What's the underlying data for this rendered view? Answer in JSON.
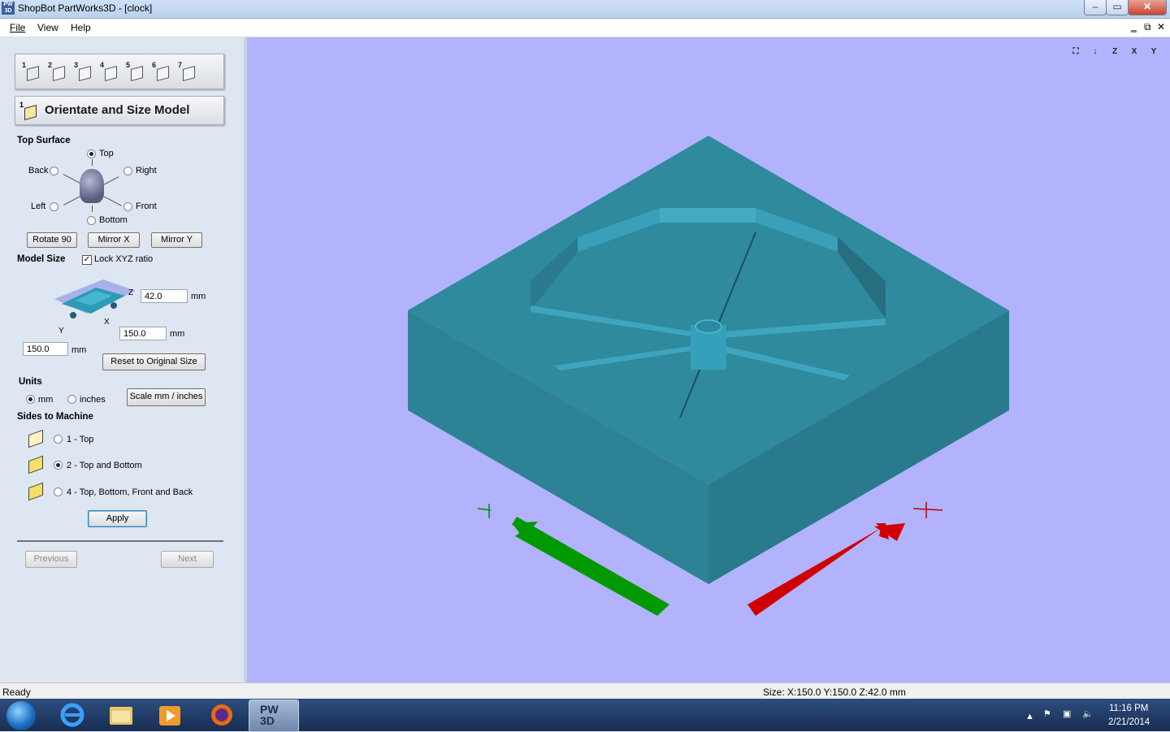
{
  "window": {
    "title": "ShopBot PartWorks3D - [clock]",
    "app_icon_text": "PW\n3D"
  },
  "menu": {
    "items": [
      "File",
      "View",
      "Help"
    ]
  },
  "panel": {
    "steps": [
      "1",
      "2",
      "3",
      "4",
      "5",
      "6",
      "7"
    ],
    "header_title": "Orientate and Size Model",
    "top_surface": {
      "label": "Top Surface",
      "options": {
        "top": "Top",
        "back": "Back",
        "right": "Right",
        "left": "Left",
        "front": "Front",
        "bottom": "Bottom"
      },
      "selected": "Top"
    },
    "buttons": {
      "rotate": "Rotate 90",
      "mirror_x": "Mirror X",
      "mirror_y": "Mirror Y"
    },
    "model_size": {
      "label": "Model Size",
      "lock_label": "Lock XYZ ratio",
      "lock_checked": true,
      "z_value": "42.0",
      "x_value": "150.0",
      "y_value": "150.0",
      "unit": "mm",
      "axis_z": "Z",
      "axis_x": "X",
      "axis_y": "Y",
      "reset_label": "Reset to Original Size"
    },
    "units": {
      "label": "Units",
      "mm": "mm",
      "inches": "inches",
      "selected": "mm",
      "scale_label": "Scale mm / inches"
    },
    "sides": {
      "label": "Sides to Machine",
      "options": [
        "1 - Top",
        "2 - Top and Bottom",
        "4 - Top, Bottom, Front and Back"
      ],
      "selected_index": 1
    },
    "apply_label": "Apply",
    "previous_label": "Previous",
    "next_label": "Next"
  },
  "viewport": {
    "background": "#b2b3fc",
    "model_color": "#2f8a9e",
    "view_icons": [
      "zoom-extents-icon",
      "iso-view-icon",
      "view-z-icon",
      "view-x-icon",
      "view-y-icon"
    ],
    "view_icon_labels": [
      "⛶",
      "↓",
      "Z",
      "X",
      "Y"
    ]
  },
  "status": {
    "ready": "Ready",
    "size": "Size: X:150.0 Y:150.0 Z:42.0 mm"
  },
  "taskbar": {
    "time": "11:16 PM",
    "date": "2/21/2014",
    "pw3d_label": "PW\n3D"
  }
}
